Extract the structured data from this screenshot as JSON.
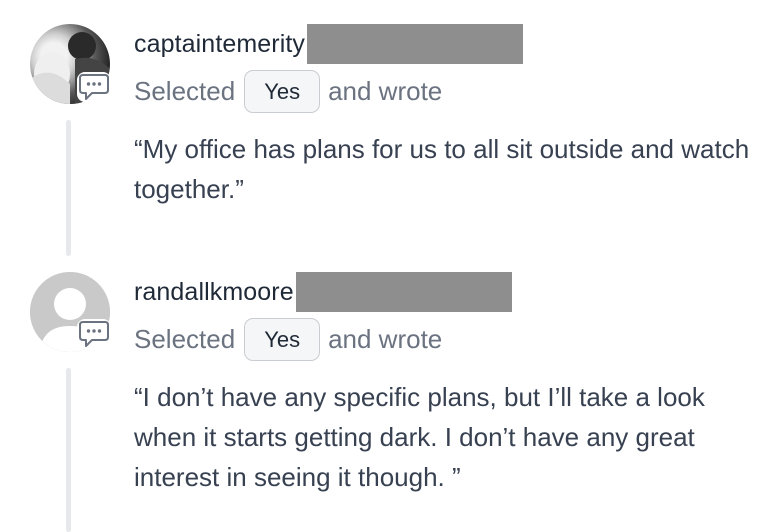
{
  "comments": [
    {
      "username": "captaintemerity",
      "selected_label": "Selected",
      "choice": "Yes",
      "wrote_label": "and wrote",
      "text": "“My office has plans for us to all sit outside and watch together.”"
    },
    {
      "username": "randallkmoore",
      "selected_label": "Selected",
      "choice": "Yes",
      "wrote_label": "and wrote",
      "text": "“I don’t have any specific plans, but I’ll take a look when it starts getting dark. I don’t have any great interest in seeing it though. ”"
    }
  ],
  "icons": {
    "comment_badge": "comment-bubble-icon",
    "default_avatar": "user-silhouette-icon"
  },
  "colors": {
    "redaction": "#8e8e8e",
    "thread_line": "#e6e8eb",
    "muted_text": "#6b7280"
  }
}
